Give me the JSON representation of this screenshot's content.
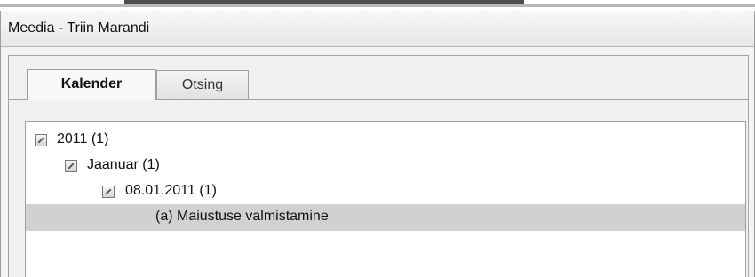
{
  "window": {
    "title": "Meedia - Triin Marandi"
  },
  "tabs": [
    {
      "label": "Kalender",
      "selected": true
    },
    {
      "label": "Otsing",
      "selected": false
    }
  ],
  "tree": {
    "items": [
      {
        "label": "2011 (1)",
        "level": 0,
        "expanded": true,
        "selected": false
      },
      {
        "label": "Jaanuar (1)",
        "level": 1,
        "expanded": true,
        "selected": false
      },
      {
        "label": "08.01.2011 (1)",
        "level": 2,
        "expanded": true,
        "selected": false
      },
      {
        "label": "(a) Maiustuse valmistamine",
        "level": 3,
        "expanded": false,
        "selected": true
      }
    ]
  },
  "colors": {
    "selection": "#d1d1d1",
    "border": "#9f9f9f",
    "background": "#f4f4f4"
  }
}
